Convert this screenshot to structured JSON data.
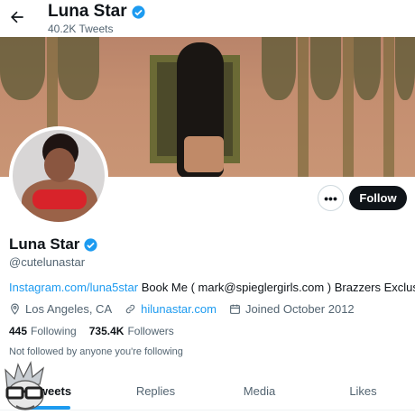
{
  "header": {
    "name": "Luna Star",
    "tweet_count": "40.2K Tweets",
    "back_icon": "arrow-left-icon",
    "verified_icon": "verified-badge-icon"
  },
  "actions": {
    "more_label": "•••",
    "follow_label": "Follow"
  },
  "profile": {
    "display_name": "Luna Star",
    "handle": "@cutelunastar",
    "bio_link": "Instagram.com/luna5star",
    "bio_text": " Book Me ( mark@spieglergirls.com ) Brazzers Exclusive",
    "location": "Los Angeles, CA",
    "website": "hilunastar.com",
    "joined": "Joined October 2012",
    "following_count": "445",
    "following_label": "Following",
    "followers_count": "735.4K",
    "followers_label": "Followers",
    "not_followed_text": "Not followed by anyone you're following"
  },
  "tabs": [
    {
      "label": "Tweets",
      "active": true
    },
    {
      "label": "Replies",
      "active": false
    },
    {
      "label": "Media",
      "active": false
    },
    {
      "label": "Likes",
      "active": false
    }
  ],
  "colors": {
    "accent": "#1d9bf0",
    "text": "#0f1419",
    "secondary": "#536471"
  }
}
